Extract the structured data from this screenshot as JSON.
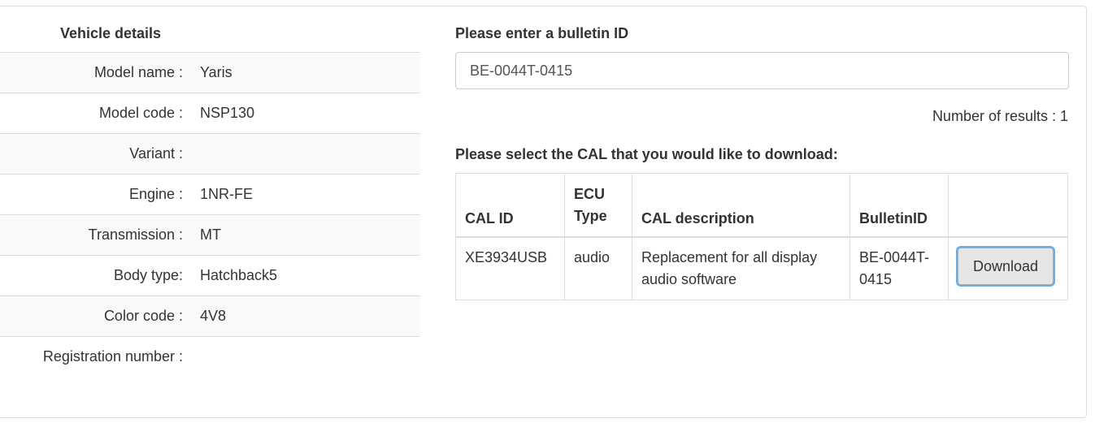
{
  "vehicle": {
    "title": "Vehicle details",
    "rows": [
      {
        "label": "Model name :",
        "value": "Yaris"
      },
      {
        "label": "Model code :",
        "value": "NSP130"
      },
      {
        "label": "Variant :",
        "value": ""
      },
      {
        "label": "Engine :",
        "value": "1NR-FE"
      },
      {
        "label": "Transmission :",
        "value": "MT"
      },
      {
        "label": "Body type:",
        "value": "Hatchback5"
      },
      {
        "label": "Color code :",
        "value": "4V8"
      },
      {
        "label": "Registration number :",
        "value": ""
      }
    ]
  },
  "bulletin": {
    "title": "Please enter a bulletin ID",
    "input_value": "BE-0044T-0415",
    "results_text": "Number of results : 1",
    "cal_prompt": "Please select the CAL that you would like to download:"
  },
  "cal_table": {
    "headers": [
      "CAL ID",
      "ECU Type",
      "CAL description",
      "BulletinID",
      ""
    ],
    "rows": [
      {
        "cal_id": "XE3934USB",
        "ecu_type": "audio",
        "description": "Replacement for all display audio software",
        "bulletin_id": "BE-0044T-0415",
        "action_label": "Download"
      }
    ]
  }
}
